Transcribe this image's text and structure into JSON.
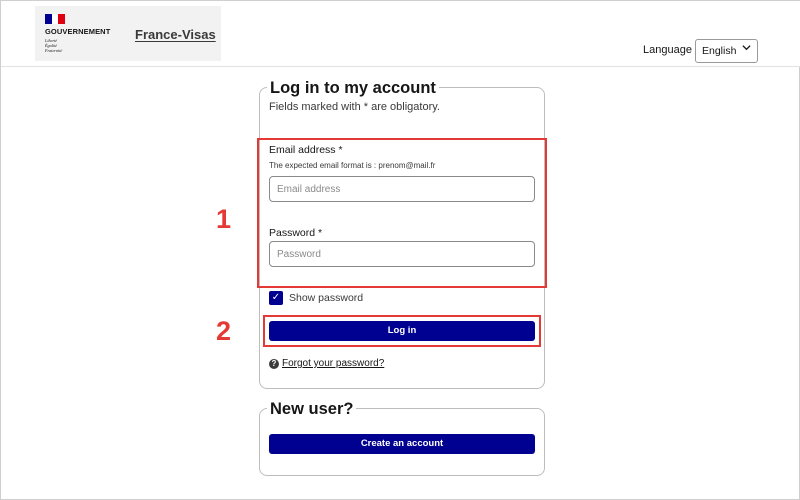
{
  "header": {
    "gov_name": "GOUVERNEMENT",
    "motto_lines": [
      "Liberté",
      "Égalité",
      "Fraternité"
    ],
    "site_title": "France-Visas",
    "language_label": "Language :",
    "language_selected": "English",
    "flag_colors": [
      "#000091",
      "#ffffff",
      "#e1000f"
    ]
  },
  "login": {
    "legend": "Log in to my account",
    "subtitle": "Fields marked with * are obligatory.",
    "email_label": "Email address *",
    "email_hint": "The expected email format is : prenom@mail.fr",
    "email_placeholder": "Email address",
    "password_label": "Password *",
    "password_placeholder": "Password",
    "show_password_label": "Show password",
    "show_password_checked": true,
    "login_button": "Log in",
    "forgot_link": "Forgot your password?"
  },
  "new_user": {
    "legend": "New user?",
    "create_button": "Create an account"
  },
  "annotations": {
    "label_1": "1",
    "label_2": "2",
    "color": "#e53935"
  },
  "icons": {
    "checkmark": "✓",
    "help": "?",
    "chevron": "⌄"
  }
}
